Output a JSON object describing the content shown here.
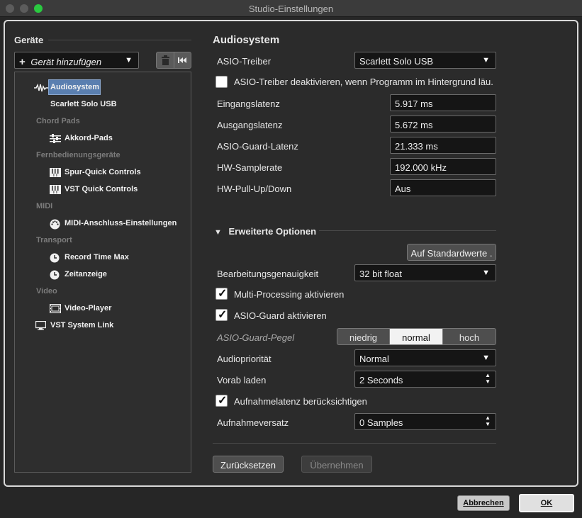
{
  "window": {
    "title": "Studio-Einstellungen"
  },
  "sidebar": {
    "heading": "Geräte",
    "add_device": "Gerät hinzufügen",
    "tree": [
      {
        "kind": "item",
        "label": "Audiosystem",
        "icon": "waveform-icon",
        "selected": true
      },
      {
        "kind": "sub",
        "label": "Scarlett Solo USB"
      },
      {
        "kind": "cat",
        "label": "Chord Pads"
      },
      {
        "kind": "item",
        "label": "Akkord-Pads",
        "icon": "sliders-icon"
      },
      {
        "kind": "cat",
        "label": "Fernbedienungsgeräte"
      },
      {
        "kind": "item",
        "label": "Spur-Quick Controls",
        "icon": "keyboard-icon"
      },
      {
        "kind": "item",
        "label": "VST Quick Controls",
        "icon": "keyboard-icon"
      },
      {
        "kind": "cat",
        "label": "MIDI"
      },
      {
        "kind": "item",
        "label": "MIDI-Anschluss-Einstellungen",
        "icon": "midi-port-icon"
      },
      {
        "kind": "cat",
        "label": "Transport"
      },
      {
        "kind": "item",
        "label": "Record Time Max",
        "icon": "clock-icon"
      },
      {
        "kind": "item",
        "label": "Zeitanzeige",
        "icon": "clock-icon"
      },
      {
        "kind": "cat",
        "label": "Video"
      },
      {
        "kind": "item",
        "label": "Video-Player",
        "icon": "film-icon"
      },
      {
        "kind": "root",
        "label": "VST System Link",
        "icon": "monitor-icon"
      }
    ]
  },
  "main": {
    "title": "Audiosystem",
    "driver_label": "ASIO-Treiber",
    "driver_value": "Scarlett Solo USB",
    "deactivate_label": "ASIO-Treiber deaktivieren, wenn Programm im Hintergrund läu.",
    "latency": [
      {
        "label": "Eingangslatenz",
        "value": "5.917 ms"
      },
      {
        "label": "Ausgangslatenz",
        "value": "5.672 ms"
      },
      {
        "label": "ASIO-Guard-Latenz",
        "value": "21.333 ms"
      },
      {
        "label": "HW-Samplerate",
        "value": "192.000 kHz"
      },
      {
        "label": "HW-Pull-Up/Down",
        "value": "Aus"
      }
    ],
    "advanced": {
      "heading": "Erweiterte Optionen",
      "defaults_button": "Auf Standardwerte .",
      "precision_label": "Bearbeitungsgenauigkeit",
      "precision_value": "32 bit float",
      "multiproc_label": "Multi-Processing aktivieren",
      "asioguard_label": "ASIO-Guard aktivieren",
      "guard_level_label": "ASIO-Guard-Pegel",
      "guard_levels": [
        "niedrig",
        "normal",
        "hoch"
      ],
      "guard_level_selected": "normal",
      "priority_label": "Audiopriorität",
      "priority_value": "Normal",
      "preload_label": "Vorab laden",
      "preload_value": "2 Seconds",
      "reclatency_label": "Aufnahmelatenz berücksichtigen",
      "recoffset_label": "Aufnahmeversatz",
      "recoffset_value": "0 Samples"
    },
    "reset_button": "Zurücksetzen",
    "apply_button": "Übernehmen"
  },
  "footer": {
    "cancel_button": "Abbrechen",
    "ok_button": "OK"
  },
  "colors": {
    "selection": "#5a7fb0",
    "traffic_close": "#6a6a6a",
    "traffic_green": "#2ac940"
  }
}
